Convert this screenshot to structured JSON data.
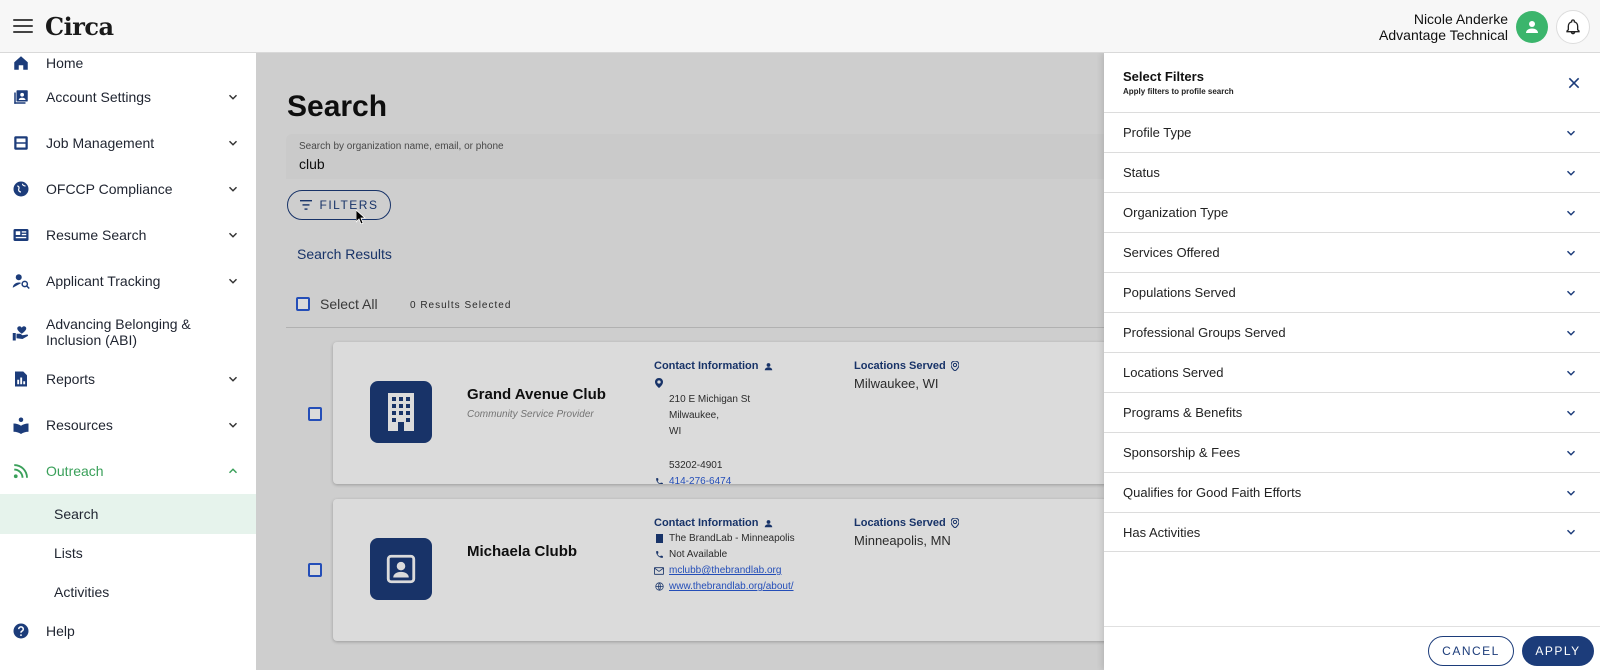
{
  "header": {
    "logo": "Circa",
    "user_name": "Nicole Anderke",
    "org_name": "Advantage Technical",
    "avatar_color": "#3bb56c"
  },
  "sidebar": {
    "items": [
      {
        "label": "Home",
        "icon": "home-icon"
      },
      {
        "label": "Account Settings",
        "icon": "account-settings-icon"
      },
      {
        "label": "Job Management",
        "icon": "job-management-icon"
      },
      {
        "label": "OFCCP Compliance",
        "icon": "globe-icon"
      },
      {
        "label": "Resume Search",
        "icon": "resume-icon"
      },
      {
        "label": "Applicant Tracking",
        "icon": "applicant-tracking-icon"
      },
      {
        "label": "Advancing Belonging & Inclusion (ABI)",
        "icon": "inclusion-icon"
      },
      {
        "label": "Reports",
        "icon": "reports-icon"
      },
      {
        "label": "Resources",
        "icon": "resources-icon"
      },
      {
        "label": "Outreach",
        "icon": "outreach-icon"
      }
    ],
    "outreach_sub": [
      "Search",
      "Lists",
      "Activities"
    ],
    "help": "Help",
    "accent_color": "#3aa05a"
  },
  "main": {
    "title": "Search",
    "search": {
      "placeholder": "Search by organization name, email, or phone",
      "value": "club"
    },
    "filters_button": "FILTERS",
    "results_heading": "Search Results",
    "select_all": "Select All",
    "selected_count": "0 Results Selected",
    "contact_heading": "Contact Information",
    "locations_heading": "Locations Served",
    "results": [
      {
        "name": "Grand Avenue Club",
        "type": "Community Service Provider",
        "address_line1": "210 E Michigan St",
        "address_line2": "Milwaukee,",
        "address_line3": "WI",
        "zip": "53202-4901",
        "phone": "414-276-6474",
        "location": "Milwaukee, WI"
      },
      {
        "name": "Michaela Clubb",
        "org": "The BrandLab - Minneapolis",
        "phone": "Not Available",
        "email": "mclubb@thebrandlab.org",
        "website": "www.thebrandlab.org/about/",
        "location": "Minneapolis, MN"
      }
    ]
  },
  "filter_panel": {
    "title": "Select Filters",
    "subtitle": "Apply filters to profile search",
    "filters": [
      "Profile Type",
      "Status",
      "Organization Type",
      "Services Offered",
      "Populations Served",
      "Professional Groups Served",
      "Locations Served",
      "Programs & Benefits",
      "Sponsorship & Fees",
      "Qualifies for Good Faith Efforts",
      "Has Activities"
    ],
    "cancel_label": "CANCEL",
    "apply_label": "APPLY"
  },
  "colors": {
    "brand_blue": "#1c3c7a",
    "link_blue": "#2a5bd7"
  }
}
